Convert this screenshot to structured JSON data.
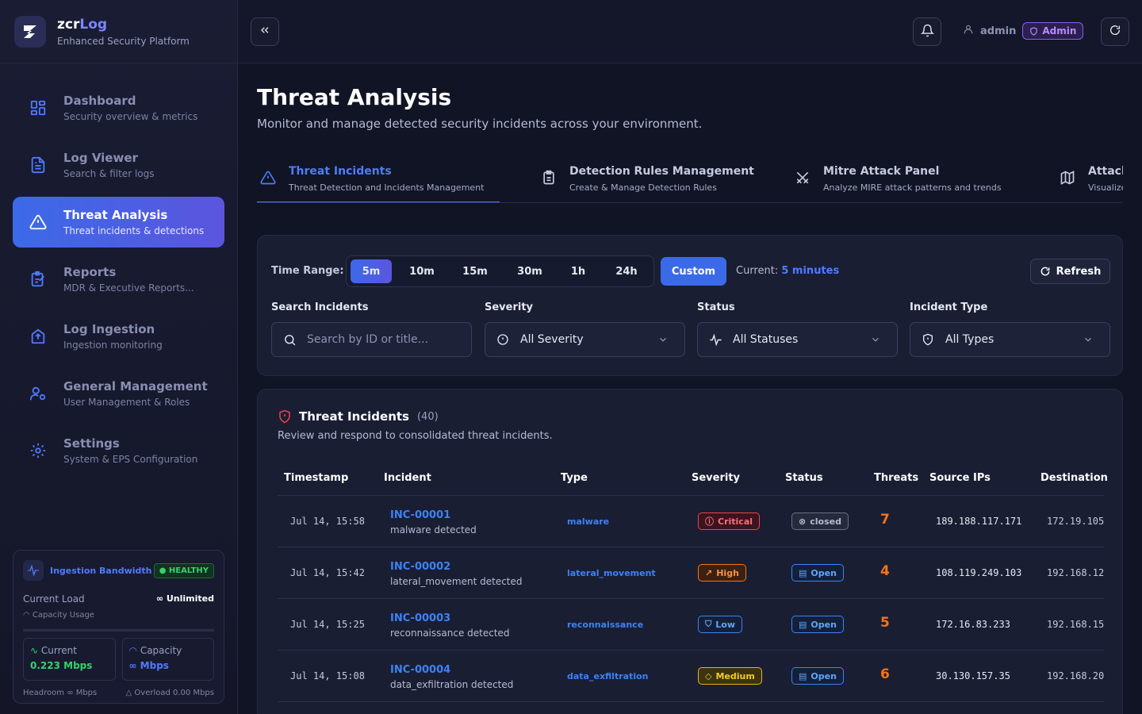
{
  "brand": {
    "name_prefix": "zcr",
    "name_accent": "Log",
    "subtitle": "Enhanced Security Platform"
  },
  "nav": [
    {
      "title": "Dashboard",
      "sub": "Security overview & metrics",
      "icon": "grid-icon"
    },
    {
      "title": "Log Viewer",
      "sub": "Search & filter logs",
      "icon": "document-icon"
    },
    {
      "title": "Threat Analysis",
      "sub": "Threat incidents & detections",
      "icon": "warning-icon",
      "active": true
    },
    {
      "title": "Reports",
      "sub": "MDR & Executive Reports...",
      "icon": "report-icon"
    },
    {
      "title": "Log Ingestion",
      "sub": "Ingestion monitoring",
      "icon": "upload-icon"
    },
    {
      "title": "General Management",
      "sub": "User Management & Roles",
      "icon": "users-cog-icon"
    },
    {
      "title": "Settings",
      "sub": "System & EPS Configuration",
      "icon": "gear-icon"
    }
  ],
  "bandwidth": {
    "title": "Ingestion Bandwidth",
    "status": "HEALTHY",
    "current_load_label": "Current Load",
    "current_load_value": "∞ Unlimited",
    "capacity_usage_label": "Capacity Usage",
    "current_label": "Current",
    "current_value": "0.223 Mbps",
    "capacity_label": "Capacity",
    "capacity_value": "∞ Mbps",
    "headroom": "Headroom ∞ Mbps",
    "overload": "Overload 0.00 Mbps"
  },
  "topbar": {
    "user": "admin",
    "role": "Admin"
  },
  "page": {
    "title": "Threat Analysis",
    "subtitle": "Monitor and manage detected security incidents across your environment."
  },
  "tabs": [
    {
      "title": "Threat Incidents",
      "sub": "Threat Detection and Incidents Management",
      "icon": "warning-icon",
      "active": true
    },
    {
      "title": "Detection Rules Management",
      "sub": "Create & Manage Detection Rules",
      "icon": "clipboard-icon"
    },
    {
      "title": "Mitre Attack Panel",
      "sub": "Analyze MIRE attack patterns and trends",
      "icon": "swords-icon"
    },
    {
      "title": "Attack",
      "sub": "Visualize",
      "icon": "map-icon"
    }
  ],
  "filters": {
    "time_range_label": "Time Range:",
    "ranges": [
      "5m",
      "10m",
      "15m",
      "30m",
      "1h",
      "24h"
    ],
    "selected_range": "5m",
    "custom_label": "Custom",
    "current_label": "Current:",
    "current_value": "5 minutes",
    "refresh_label": "Refresh",
    "search_label": "Search Incidents",
    "search_placeholder": "Search by ID or title...",
    "severity_label": "Severity",
    "severity_value": "All Severity",
    "status_label": "Status",
    "status_value": "All Statuses",
    "type_label": "Incident Type",
    "type_value": "All Types"
  },
  "incidents": {
    "title": "Threat Incidents",
    "count": "(40)",
    "subtitle": "Review and respond to consolidated threat incidents.",
    "columns": [
      "Timestamp",
      "Incident",
      "Type",
      "Severity",
      "Status",
      "Threats",
      "Source IPs",
      "Destination"
    ],
    "rows": [
      {
        "ts": "Jul 14, 15:58",
        "id": "INC-00001",
        "desc": "malware detected",
        "type": "malware",
        "severity": "Critical",
        "sev_class": "critical",
        "status": "closed",
        "status_class": "closed",
        "threats": "7",
        "src": "189.188.117.171",
        "dst": "172.19.105"
      },
      {
        "ts": "Jul 14, 15:42",
        "id": "INC-00002",
        "desc": "lateral_movement detected",
        "type": "lateral_movement",
        "severity": "High",
        "sev_class": "high",
        "status": "Open",
        "status_class": "open",
        "threats": "4",
        "src": "108.119.249.103",
        "dst": "192.168.12"
      },
      {
        "ts": "Jul 14, 15:25",
        "id": "INC-00003",
        "desc": "reconnaissance detected",
        "type": "reconnaissance",
        "severity": "Low",
        "sev_class": "low",
        "status": "Open",
        "status_class": "open",
        "threats": "5",
        "src": "172.16.83.233",
        "dst": "192.168.15"
      },
      {
        "ts": "Jul 14, 15:08",
        "id": "INC-00004",
        "desc": "data_exfiltration detected",
        "type": "data_exfiltration",
        "severity": "Medium",
        "sev_class": "medium",
        "status": "Open",
        "status_class": "open",
        "threats": "6",
        "src": "30.130.157.35",
        "dst": "192.168.20"
      }
    ]
  },
  "colors": {
    "accent": "#4f7bff",
    "critical": "#ef4444",
    "high": "#f97316",
    "low": "#3b82f6",
    "medium": "#eab308",
    "healthy": "#34d36a",
    "admin": "#8b5cf6"
  }
}
